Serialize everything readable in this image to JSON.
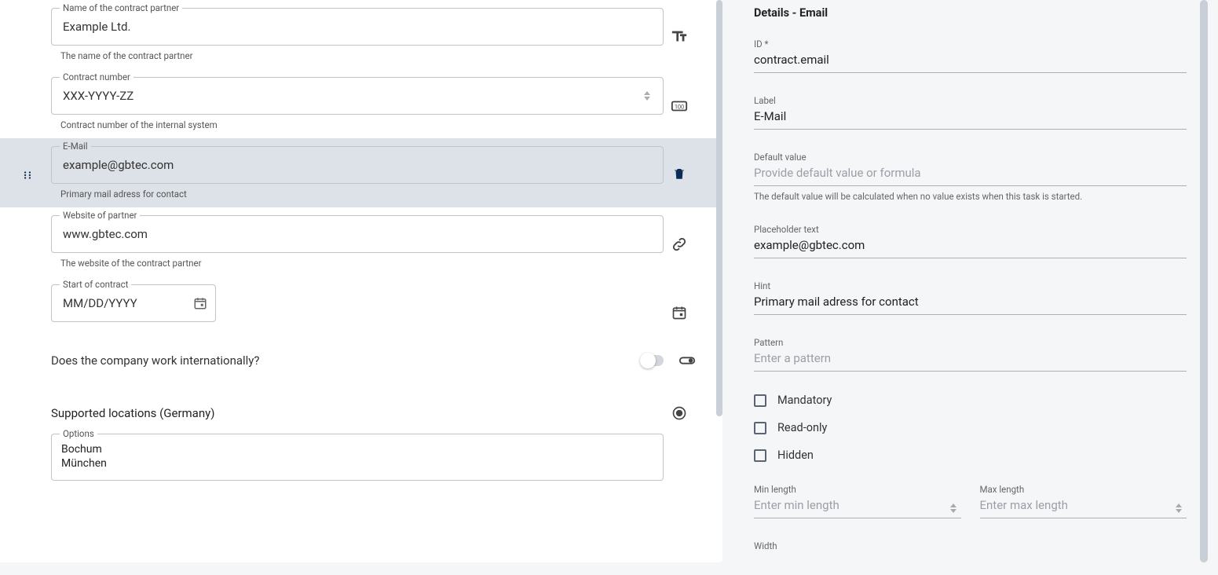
{
  "form": {
    "fields": [
      {
        "label": "Name of the contract partner",
        "placeholder": "Example Ltd.",
        "hint": "The name of the contract partner",
        "type": "text"
      },
      {
        "label": "Contract number",
        "placeholder": "XXX-YYYY-ZZ",
        "hint": "Contract number of the internal system",
        "type": "number"
      },
      {
        "label": "E-Mail",
        "placeholder": "example@gbtec.com",
        "hint": "Primary mail adress for contact",
        "type": "email",
        "selected": true
      },
      {
        "label": "Website of partner",
        "placeholder": "www.gbtec.com",
        "hint": "The website of the contract partner",
        "type": "link"
      },
      {
        "label": "Start of contract",
        "placeholder": "MM/DD/YYYY",
        "type": "date"
      }
    ],
    "boolean_question": "Does the company work internationally?",
    "radio_question": "Supported locations (Germany)",
    "options_label": "Options",
    "options": [
      "Bochum",
      "München"
    ]
  },
  "details": {
    "title": "Details - Email",
    "id_label": "ID *",
    "id_value": "contract.email",
    "label_label": "Label",
    "label_value": "E-Mail",
    "default_label": "Default value",
    "default_placeholder": "Provide default value or formula",
    "default_hint": "The default value will be calculated when no value exists when this task is started.",
    "placeholder_label": "Placeholder text",
    "placeholder_value": "example@gbtec.com",
    "hint_label": "Hint",
    "hint_value": "Primary mail adress for contact",
    "pattern_label": "Pattern",
    "pattern_placeholder": "Enter a pattern",
    "mandatory_label": "Mandatory",
    "readonly_label": "Read-only",
    "hidden_label": "Hidden",
    "min_label": "Min length",
    "min_placeholder": "Enter min length",
    "max_label": "Max length",
    "max_placeholder": "Enter max length",
    "width_label": "Width"
  }
}
